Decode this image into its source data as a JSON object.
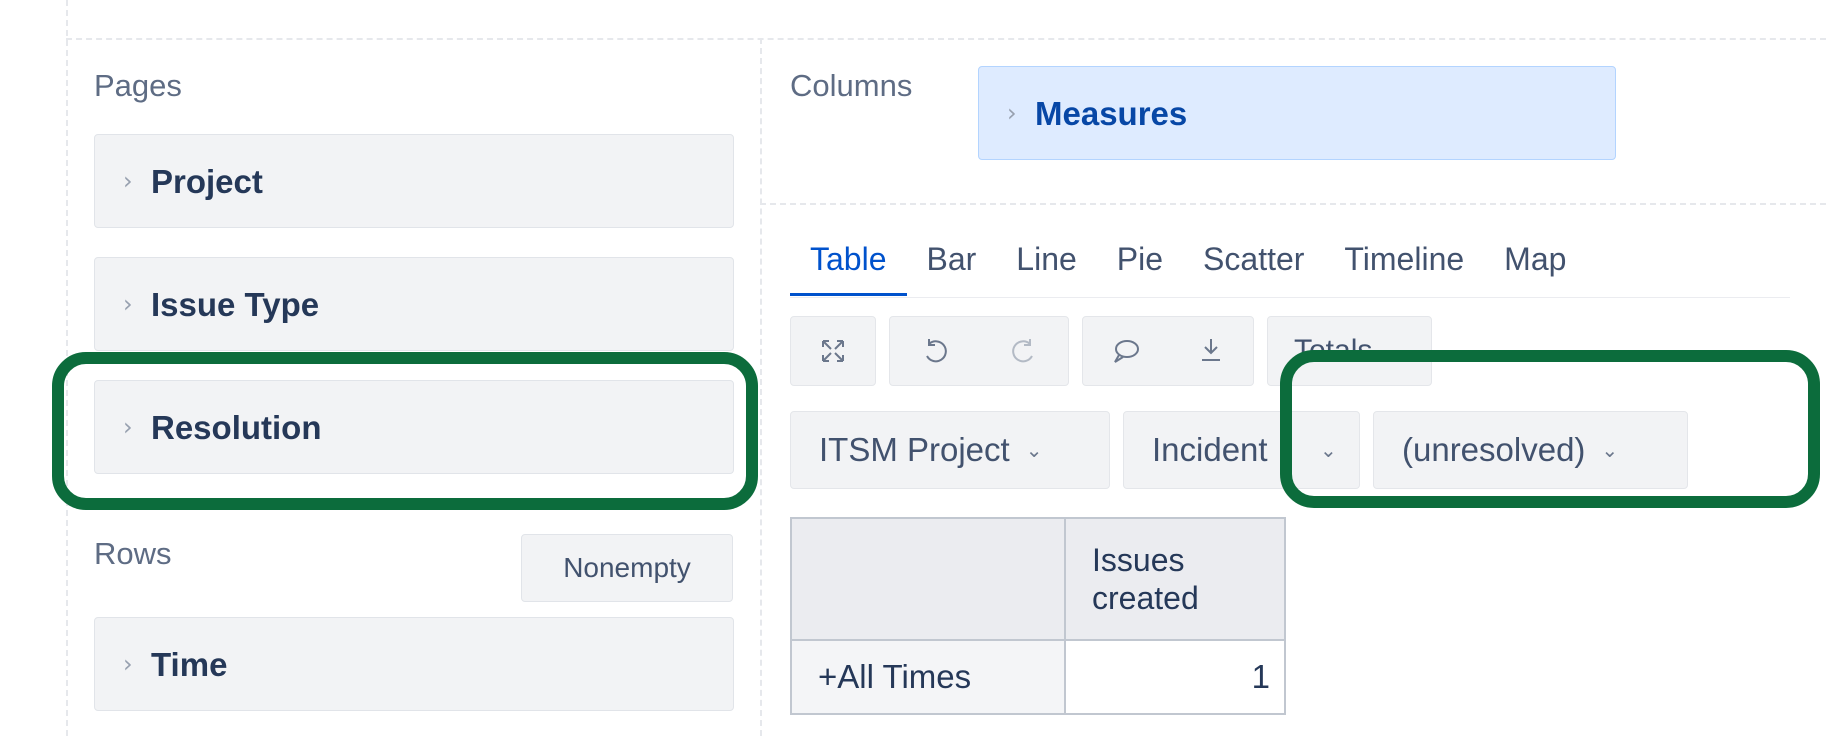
{
  "pages_panel": {
    "label": "Pages",
    "items": [
      {
        "label": "Project"
      },
      {
        "label": "Issue Type"
      },
      {
        "label": "Resolution"
      }
    ]
  },
  "rows_panel": {
    "label": "Rows",
    "nonempty_label": "Nonempty",
    "items": [
      {
        "label": "Time"
      }
    ]
  },
  "columns_panel": {
    "label": "Columns",
    "items": [
      {
        "label": "Measures"
      }
    ]
  },
  "view_tabs": {
    "active": "Table",
    "items": [
      {
        "label": "Table"
      },
      {
        "label": "Bar"
      },
      {
        "label": "Line"
      },
      {
        "label": "Pie"
      },
      {
        "label": "Scatter"
      },
      {
        "label": "Timeline"
      },
      {
        "label": "Map"
      }
    ]
  },
  "toolbar": {
    "fullscreen_icon": "expand-icon",
    "undo_icon": "undo-icon",
    "redo_icon": "redo-icon",
    "comment_icon": "comment-icon",
    "export_icon": "download-icon",
    "totals_label": "Totals"
  },
  "page_filters": [
    {
      "value": "ITSM Project"
    },
    {
      "value": "Incident"
    },
    {
      "value": "(unresolved)"
    }
  ],
  "pivot_table": {
    "column_header": "Issues created",
    "rows": [
      {
        "label": "All Times",
        "expand_symbol": "+",
        "value": "1"
      }
    ]
  },
  "annotation_color": "#0c6c3c"
}
